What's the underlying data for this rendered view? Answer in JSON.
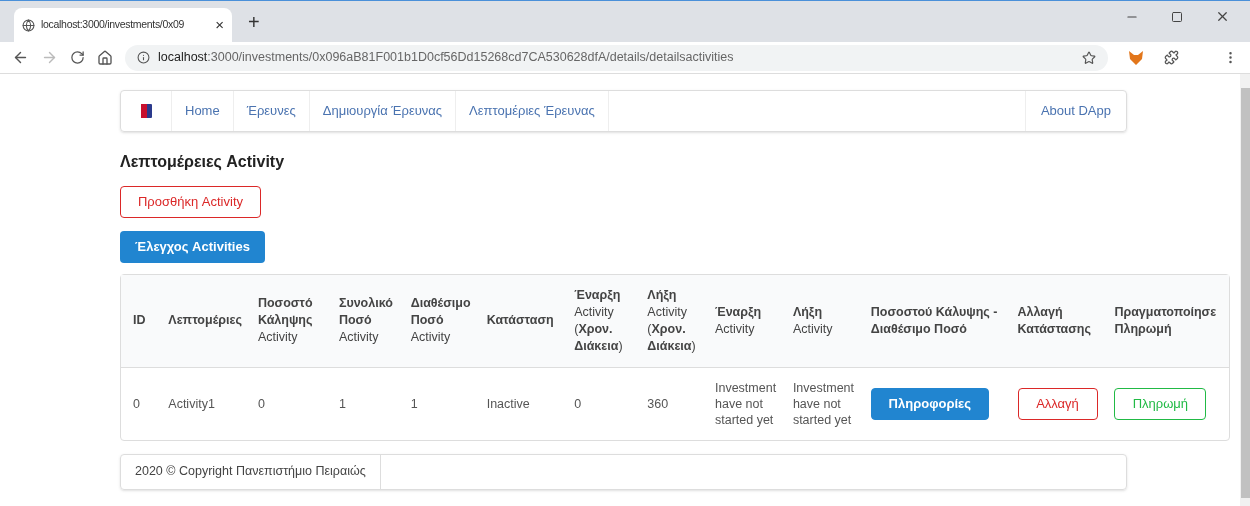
{
  "browser": {
    "tab_title": "localhost:3000/investments/0x09",
    "tab_close": "×",
    "new_tab": "+",
    "url_host": "localhost",
    "url_rest": ":3000/investments/0x096aB81F001b1D0cf56Dd15268cd7CA530628dfA/details/detailsactivities"
  },
  "navbar": {
    "items": [
      {
        "label": "Home"
      },
      {
        "label": "Έρευνες"
      },
      {
        "label": "Δημιουργία Έρευνας"
      },
      {
        "label": "Λεπτομέριες Έρευνας"
      }
    ],
    "right_item": "About DApp"
  },
  "heading": "Λεπτομέρειες Activity",
  "add_button": "Προσθήκη Activity",
  "check_button": "Έλεγχος Activities",
  "table": {
    "columns": [
      "**ID**",
      "**Λεπτομέριες**",
      "**Ποσοστό Κάληψης** Activity",
      "**Συνολικό Ποσό** Activity",
      "**Διαθέσιμο Ποσό** Activity",
      "**Κατάσταση**",
      "**Έναρξη** Activity (**Χρον. Διάκεια**)",
      "**Λήξη** Activity (**Χρον. Διάκεια**)",
      "**Έναρξη** Activity",
      "**Λήξη** Activity",
      "**Ποσοστού Κάλυψης - Διαθέσιμο Ποσό**",
      "**Αλλαγή Κατάστασης**",
      "**Πραγματοποίησε Πληρωμή**"
    ],
    "rows": [
      {
        "cells": [
          {
            "kind": "text",
            "text": "0"
          },
          {
            "kind": "text",
            "text": "Activity1"
          },
          {
            "kind": "text",
            "text": "0"
          },
          {
            "kind": "text",
            "text": "1"
          },
          {
            "kind": "text",
            "text": "1"
          },
          {
            "kind": "text",
            "text": "Inactive"
          },
          {
            "kind": "text",
            "text": "0"
          },
          {
            "kind": "text",
            "text": "360"
          },
          {
            "kind": "text",
            "text": "Investment have not started yet"
          },
          {
            "kind": "text",
            "text": "Investment have not started yet"
          },
          {
            "kind": "primary",
            "text": "Πληροφορίες"
          },
          {
            "kind": "danger",
            "text": "Αλλαγή"
          },
          {
            "kind": "success",
            "text": "Πληρωμή"
          }
        ]
      }
    ]
  },
  "footer": "2020 © Copyright Πανεπιστήμιο Πειραιώς"
}
